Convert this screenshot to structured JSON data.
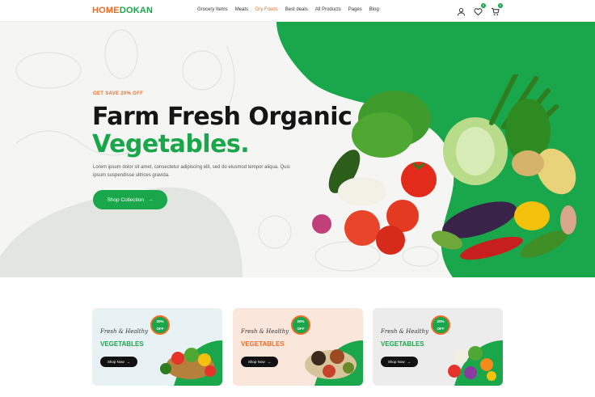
{
  "brand": {
    "part1": "HOME",
    "part2": "DOKAN"
  },
  "nav": {
    "items": [
      "Grocery Items",
      "Meats",
      "Dry Foods",
      "Best deals",
      "All Products",
      "Pages",
      "Blog"
    ],
    "active": 2
  },
  "header_icons": {
    "user": "user-icon",
    "wishlist": "heart-icon",
    "wishlist_count": "0",
    "cart": "cart-icon",
    "cart_count": "0"
  },
  "hero": {
    "tag": "GET SAVE 20% OFF",
    "title_line1": "Farm Fresh Organic",
    "title_line2": "Vegetables.",
    "description": "Lorem ipsum dolor sit amet, consectetur adipiscing elit, sed do eiusmod tempor aliqua. Quis ipsum suspendisse ultrices gravida.",
    "button_label": "Shop Collection",
    "button_icon": "arrow-right-icon"
  },
  "cards": [
    {
      "script": "Fresh & Healthy",
      "title": "VEGETABLES",
      "button": "Shop Now",
      "discount": "20%\nOFF",
      "title_color": "#1aa64a",
      "bg": "#e8f1f3"
    },
    {
      "script": "Fresh & Healthy",
      "title": "VEGETABLES",
      "button": "Shop Now",
      "discount": "20%\nOFF",
      "title_color": "#ef6c27",
      "bg": "#fbe6dc"
    },
    {
      "script": "Fresh & Healthy",
      "title": "VEGETABLES",
      "button": "Shop Now",
      "discount": "20%\nOFF",
      "title_color": "#1aa64a",
      "bg": "#ececec"
    }
  ],
  "colors": {
    "green": "#1aa64a",
    "orange": "#ef6c27"
  }
}
